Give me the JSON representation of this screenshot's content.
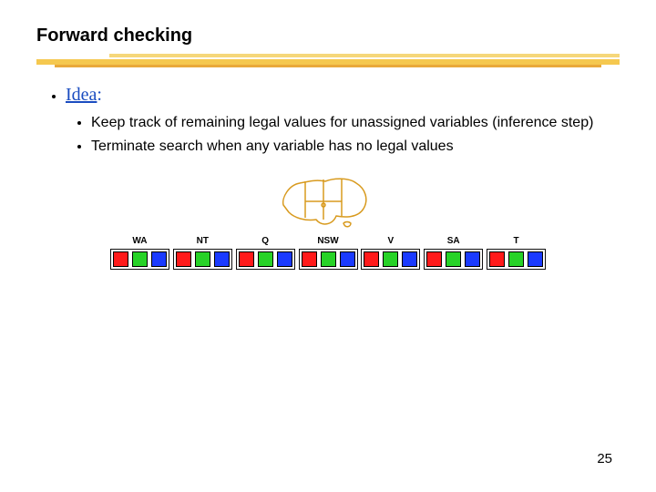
{
  "title": "Forward checking",
  "idea": {
    "label": "Idea",
    "colon": ":"
  },
  "bullets": [
    "Keep track of remaining legal values for unassigned variables (inference step)",
    "Terminate search when any variable has no legal values"
  ],
  "domains": [
    {
      "name": "WA",
      "colors": [
        "R",
        "G",
        "B"
      ]
    },
    {
      "name": "NT",
      "colors": [
        "R",
        "G",
        "B"
      ]
    },
    {
      "name": "Q",
      "colors": [
        "R",
        "G",
        "B"
      ]
    },
    {
      "name": "NSW",
      "colors": [
        "R",
        "G",
        "B"
      ]
    },
    {
      "name": "V",
      "colors": [
        "R",
        "G",
        "B"
      ]
    },
    {
      "name": "SA",
      "colors": [
        "R",
        "G",
        "B"
      ]
    },
    {
      "name": "T",
      "colors": [
        "R",
        "G",
        "B"
      ]
    }
  ],
  "page_number": "25",
  "map_stroke": "#d89a1e"
}
